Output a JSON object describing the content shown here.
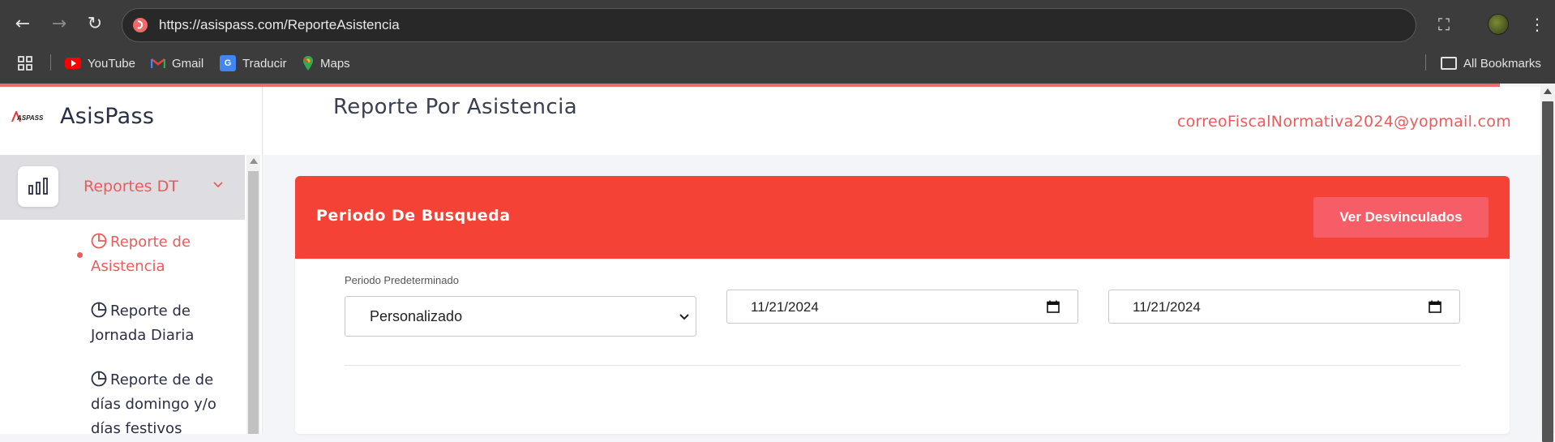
{
  "browser": {
    "url": "https://asispass.com/ReporteAsistencia",
    "bookmarks": [
      "YouTube",
      "Gmail",
      "Traducir",
      "Maps"
    ],
    "all_bookmarks": "All Bookmarks"
  },
  "sidebar": {
    "brand_name": "AsisPass",
    "logo_text": "ASPASS",
    "section_label": "Reportes DT",
    "items": [
      {
        "label": "Reporte de Asistencia"
      },
      {
        "label": "Reporte de Jornada Diaria"
      },
      {
        "label": "Reporte de de días domingo y/o días festivos"
      }
    ]
  },
  "header": {
    "title": "Reporte Por Asistencia",
    "user_email": "correoFiscalNormativa2024@yopmail.com"
  },
  "card": {
    "title": "Periodo De Busqueda",
    "button_label": "Ver Desvinculados",
    "period_label": "Periodo Predeterminado",
    "period_value": "Personalizado",
    "date_from": "11/21/2024",
    "date_to": "11/21/2024"
  },
  "colors": {
    "accent": "#ec5b5b",
    "card_header": "#f44336",
    "button": "#f75d66"
  }
}
